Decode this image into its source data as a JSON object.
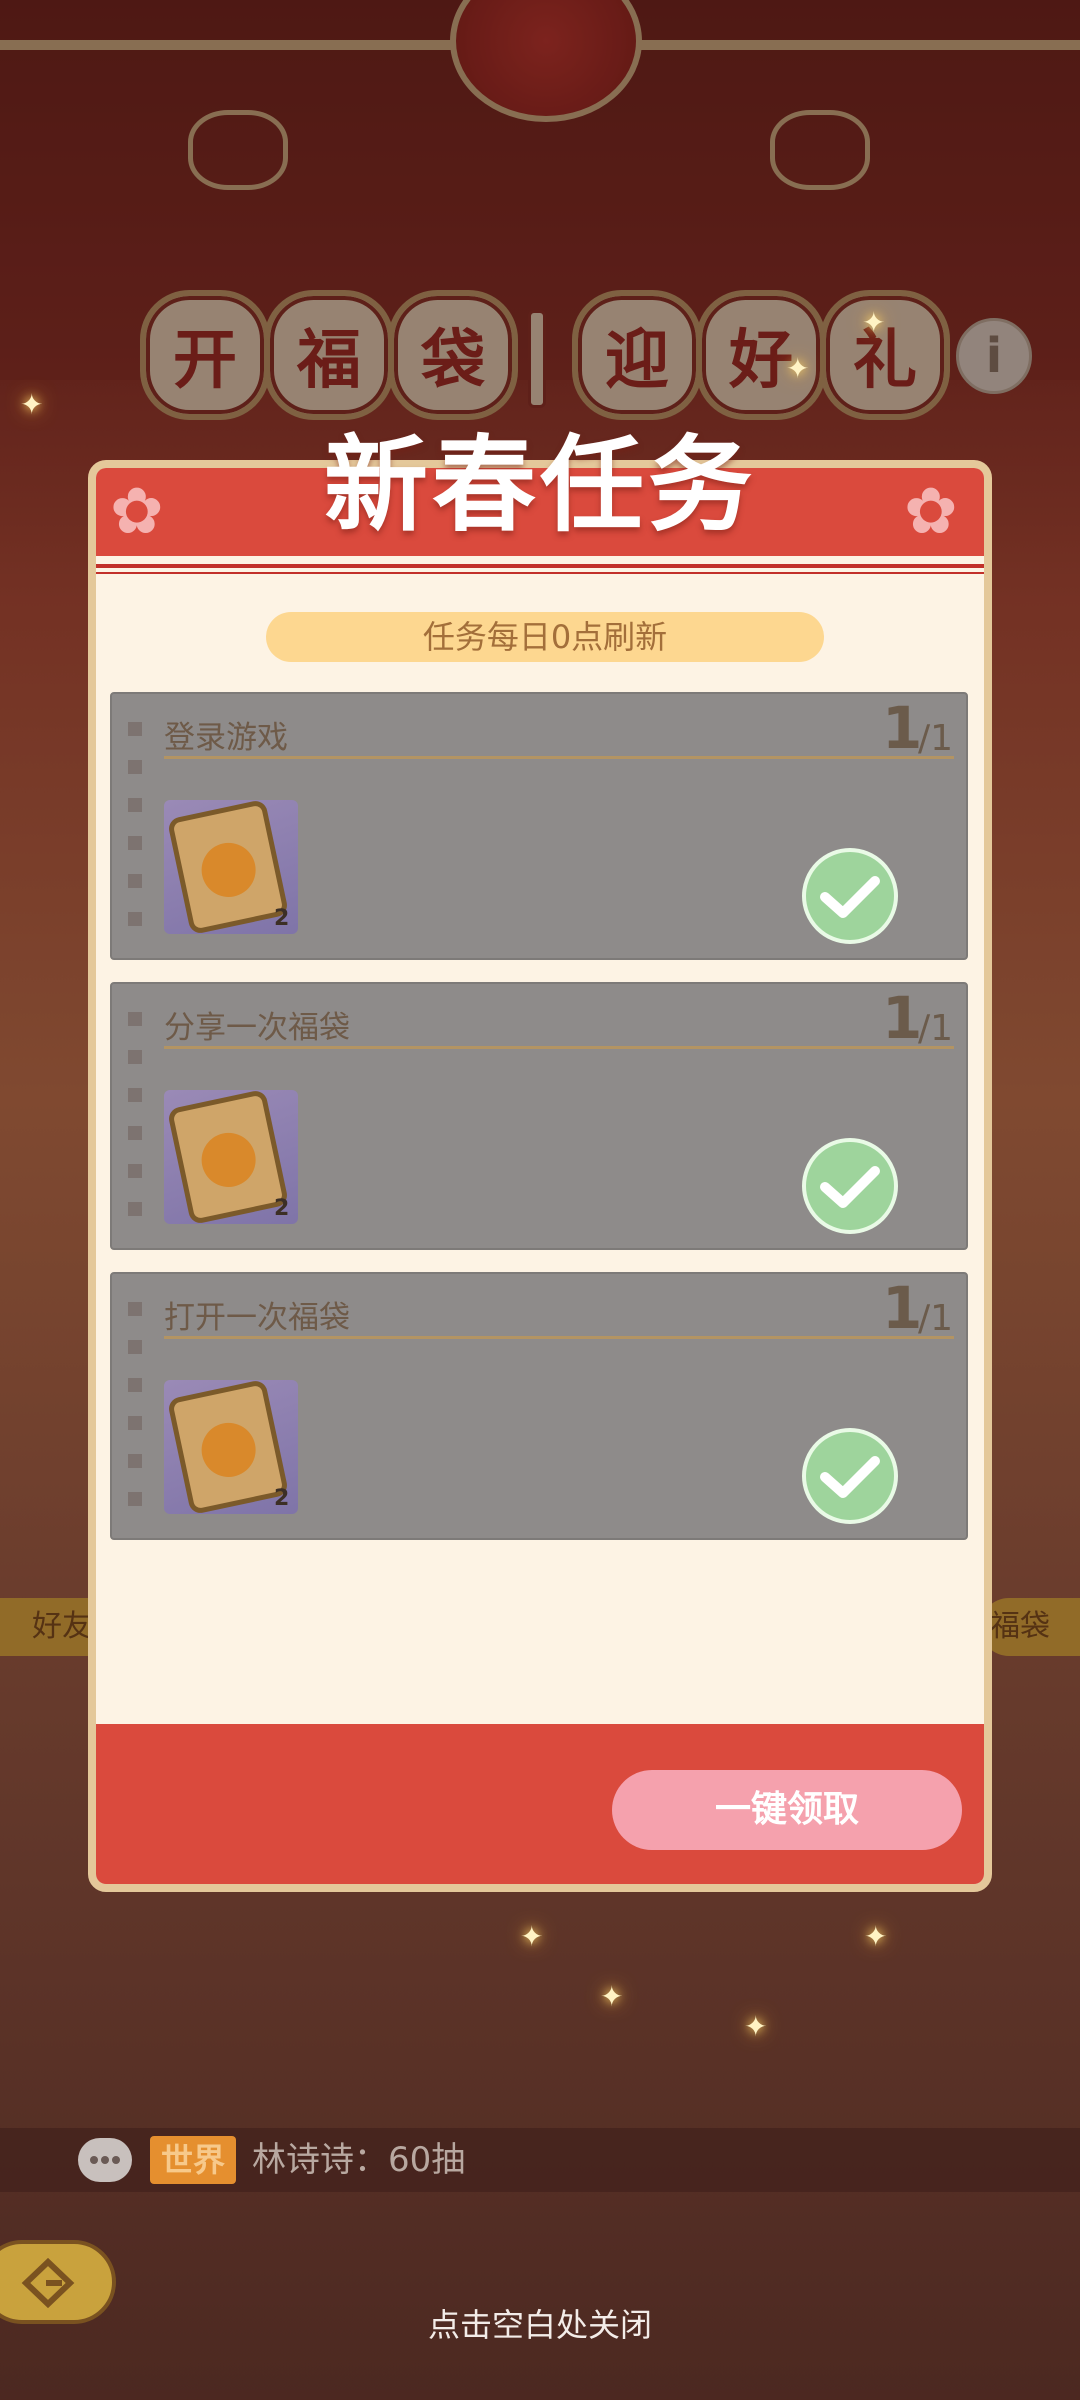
{
  "header": {
    "title_chars": [
      "开",
      "福",
      "袋",
      "迎",
      "好",
      "礼"
    ],
    "info_icon": "info-icon"
  },
  "modal": {
    "title": "新春任务",
    "refresh_note": "任务每日0点刷新",
    "tasks": [
      {
        "name": "登录游戏",
        "progress_current": "1",
        "progress_total": "/1",
        "reward_qty": "2",
        "reward_icon": "lucky-bag-icon",
        "status_icon": "check-icon"
      },
      {
        "name": "分享一次福袋",
        "progress_current": "1",
        "progress_total": "/1",
        "reward_qty": "2",
        "reward_icon": "lucky-bag-icon",
        "status_icon": "check-icon"
      },
      {
        "name": "打开一次福袋",
        "progress_current": "1",
        "progress_total": "/1",
        "reward_qty": "2",
        "reward_icon": "lucky-bag-icon",
        "status_icon": "check-icon"
      }
    ],
    "claim_all_label": "一键领取"
  },
  "background": {
    "left_strip": "好友",
    "right_strip": "福袋"
  },
  "chat": {
    "channel_tag": "世界",
    "message": "林诗诗：60抽",
    "chat_icon": "chat-bubble-icon"
  },
  "footer": {
    "close_hint": "点击空白处关闭",
    "back_icon": "back-icon"
  },
  "colors": {
    "modal_red": "#da4a3d",
    "modal_bg": "#fdf3e4",
    "claim_button": "#f5a1ad",
    "check_green": "#9ed49c"
  }
}
